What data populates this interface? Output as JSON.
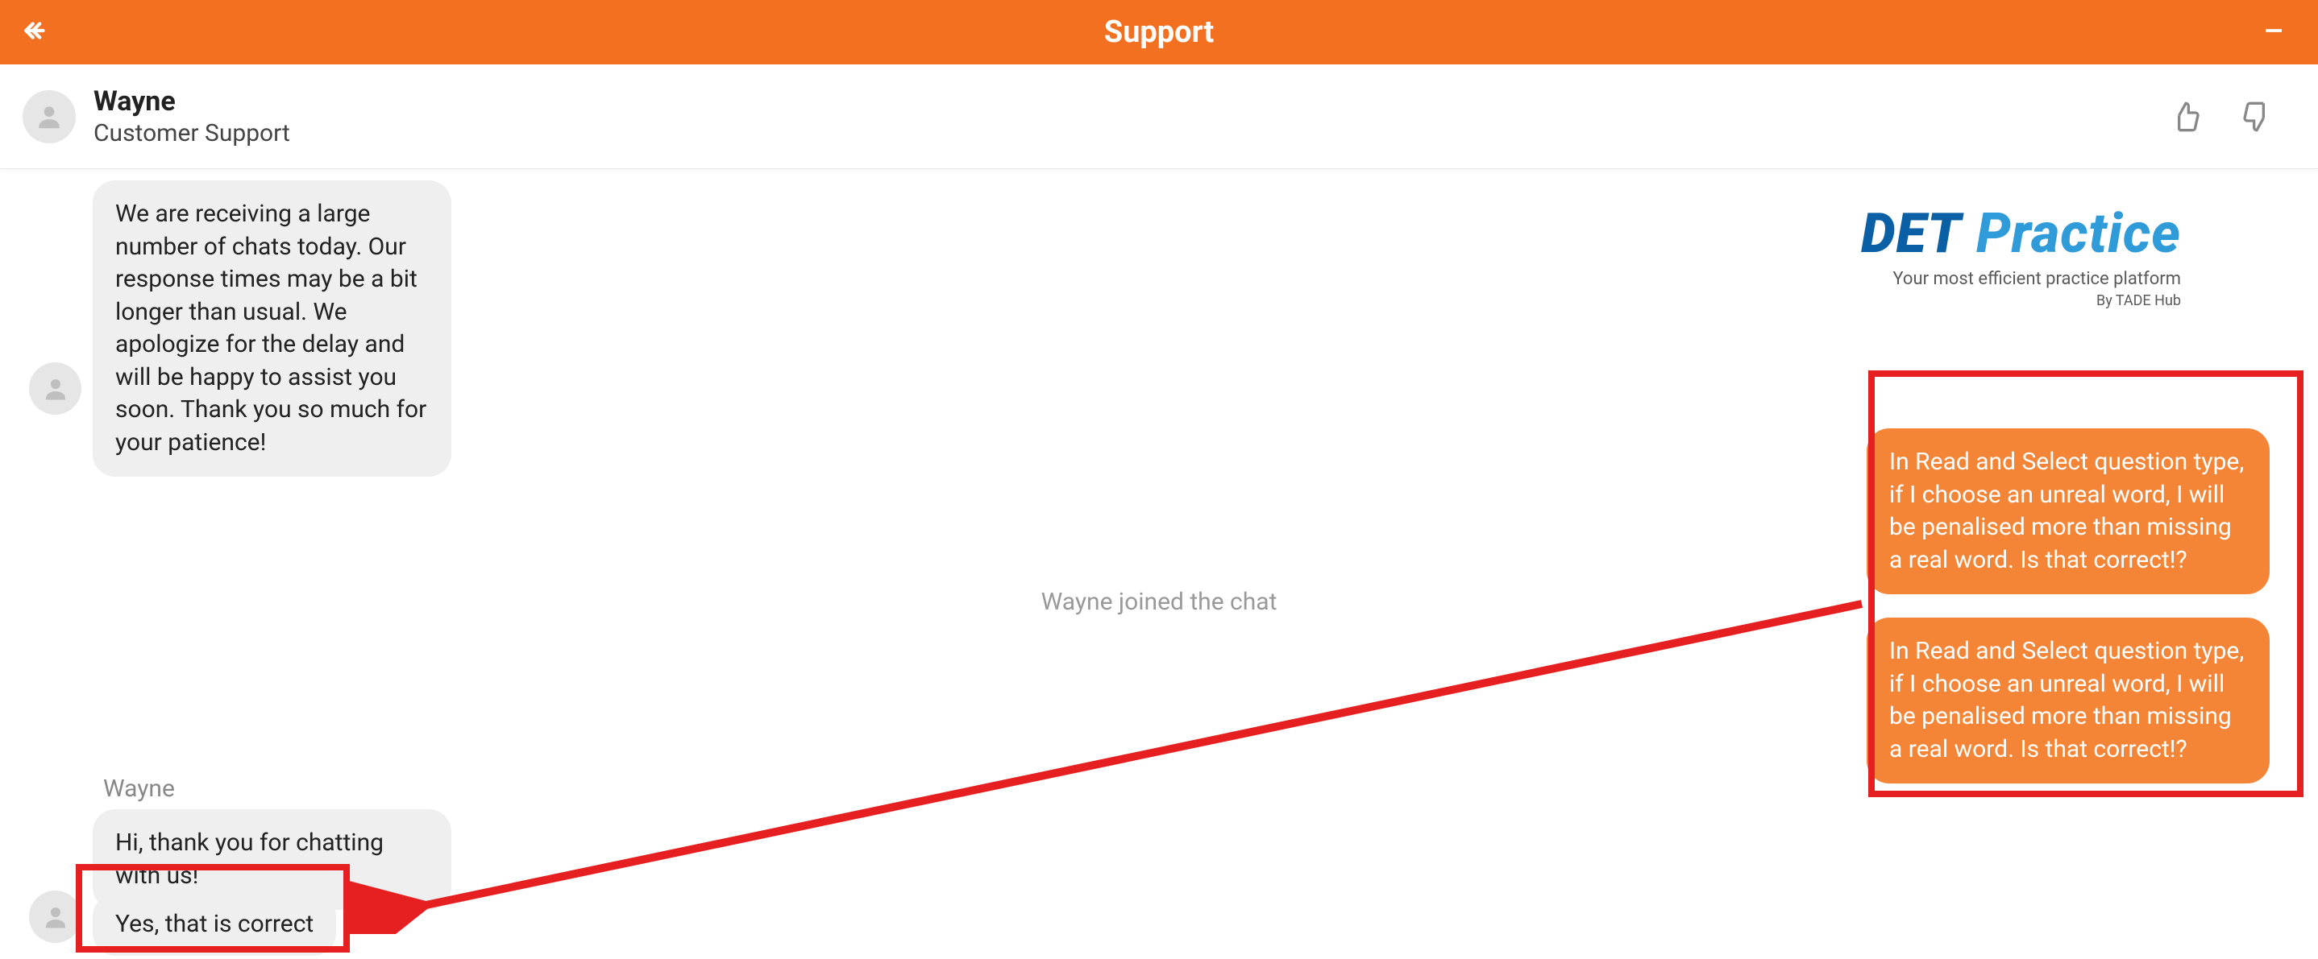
{
  "header": {
    "title": "Support"
  },
  "agent": {
    "name": "Wayne",
    "role": "Customer Support"
  },
  "system_message": "We are receiving a large number of chats today. Our response times may be a bit longer than usual. We apologize for the delay and will be happy to assist you soon. Thank you so much for your patience!",
  "status_line": "Wayne joined the chat",
  "user_messages": [
    "In Read and Select question type, if I choose an unreal word, I will be penalised more than missing a real word. Is that correct!?",
    "In Read and Select question type, if I choose an unreal word, I will be penalised more than missing a real word. Is that correct!?"
  ],
  "agent_reply_label": "Wayne",
  "agent_replies": [
    "Hi, thank you for chatting with us!",
    "Yes, that is correct"
  ],
  "brand": {
    "part1": "DET",
    "part2": "Practice",
    "tagline": "Your most efficient practice platform",
    "subline": "By TADE Hub"
  },
  "colors": {
    "accent": "#f37021",
    "highlight": "#e62020"
  }
}
